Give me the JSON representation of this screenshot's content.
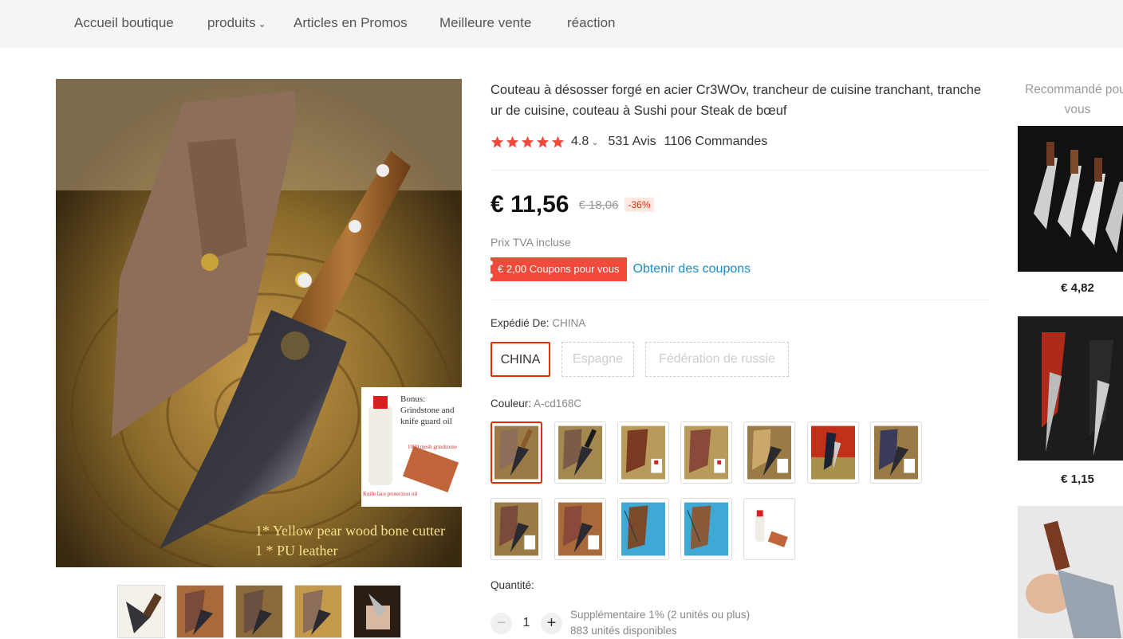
{
  "nav": {
    "items": [
      "Accueil boutique",
      "produits",
      "Articles en Promos",
      "Meilleure vente",
      "réaction"
    ],
    "chevron": "⌄"
  },
  "image": {
    "caption_bonus": "Bonus:\nGrindstone and\nknife guard oil",
    "caption_grindstone": "1000 mesh grindstone",
    "caption_oil": "Knife lace protection oil",
    "caption_line1": "1* Yellow pear wood bone cutter",
    "caption_line2": "1 * PU leather"
  },
  "product": {
    "title": "Couteau à désosser forgé en acier Cr3WOv, trancheur de cuisine tranchant, tranche ur de cuisine, couteau à Sushi pour Steak de bœuf",
    "rating": "4.8",
    "rating_chevron": "⌄",
    "reviews": "531 Avis",
    "orders": "1106 Commandes",
    "price": "€ 11,56",
    "old_price": "€ 18,06",
    "discount": "-36%",
    "vat": "Prix TVA incluse",
    "coupon": "€ 2,00 Coupons pour vous",
    "coupon_link": "Obtenir des coupons",
    "ship_label": "Expédié De:",
    "ship_value": "CHINA",
    "ship_options": [
      "CHINA",
      "Espagne",
      "Fédération de russie"
    ],
    "color_label": "Couleur:",
    "color_value": "A-cd168C",
    "qty_label": "Quantité:",
    "qty_minus": "−",
    "qty_plus": "+",
    "qty_value": "1",
    "qty_extra": "Supplémentaire 1% (2 unités ou plus)",
    "qty_stock": "883 unités disponibles"
  },
  "recommend": {
    "title": "Recommandé pour vous",
    "prices": [
      "€ 4,82",
      "€ 1,15"
    ]
  },
  "colors": {
    "accent": "#e62e04",
    "coupon": "#f24a3a",
    "link": "#1a8ccc",
    "star": "#f24a3a"
  }
}
